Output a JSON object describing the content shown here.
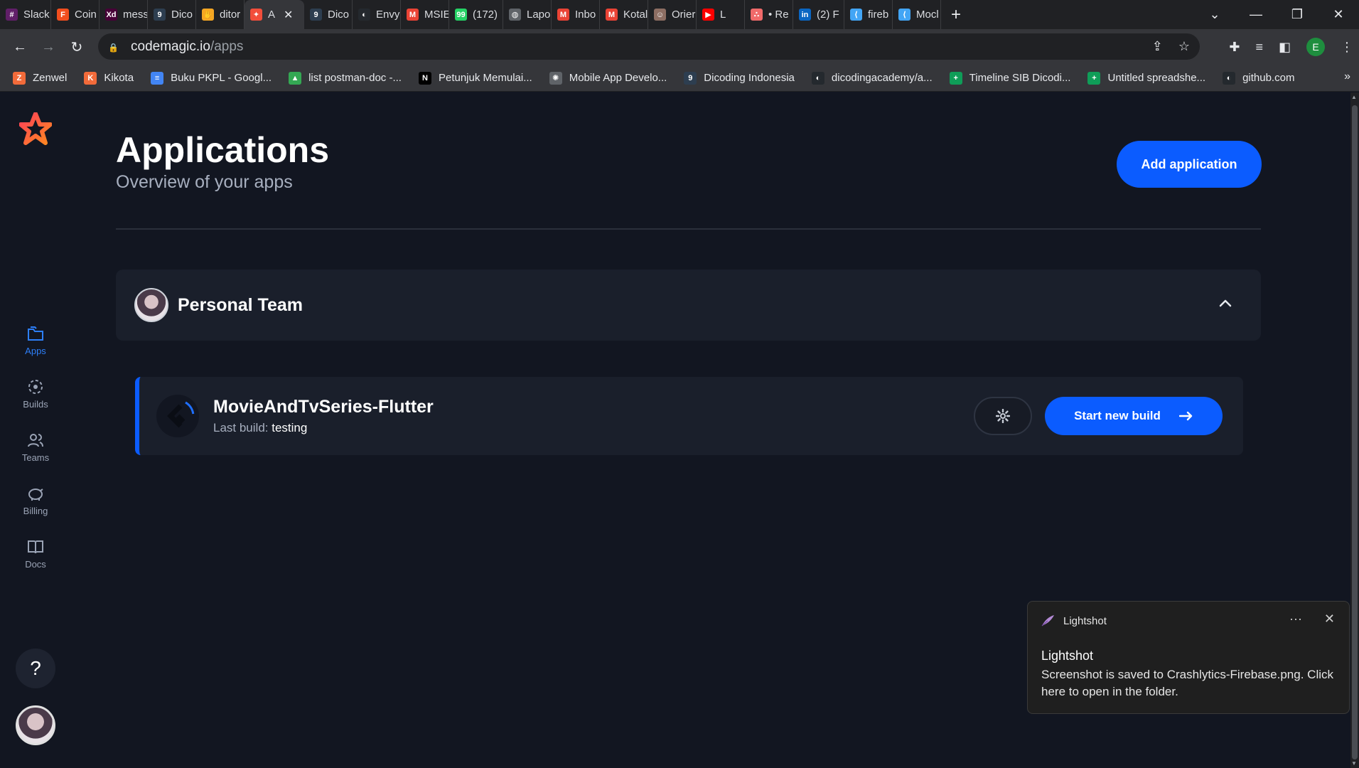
{
  "browser": {
    "tabs": [
      {
        "label": "Slack",
        "icon": "slack-icon",
        "color": "#611f69",
        "glyph": "#"
      },
      {
        "label": "Coin",
        "icon": "figma-icon",
        "color": "#f24e1e",
        "glyph": "F"
      },
      {
        "label": "mess",
        "icon": "xd-icon",
        "color": "#470137",
        "glyph": "Xd"
      },
      {
        "label": "Dico",
        "icon": "dicoding-icon",
        "color": "#2d3e50",
        "glyph": "9"
      },
      {
        "label": "ditor",
        "icon": "hand-icon",
        "color": "#f5a623",
        "glyph": "✋"
      },
      {
        "label": "A",
        "icon": "codemagic-icon",
        "color": "#f24e3b",
        "glyph": "✦",
        "active": true
      },
      {
        "label": "Dico",
        "icon": "dicoding-icon",
        "color": "#2d3e50",
        "glyph": "9"
      },
      {
        "label": "Envy",
        "icon": "github-icon",
        "color": "#24292e",
        "glyph": "◐"
      },
      {
        "label": "MSIE",
        "icon": "gmail-icon",
        "color": "#ea4335",
        "glyph": "M"
      },
      {
        "label": "(172)",
        "icon": "whatsapp-icon",
        "color": "#25d366",
        "glyph": "99"
      },
      {
        "label": "Lapo",
        "icon": "globe-icon",
        "color": "#5f6368",
        "glyph": "◍"
      },
      {
        "label": "Inbo",
        "icon": "gmail-icon",
        "color": "#ea4335",
        "glyph": "M"
      },
      {
        "label": "Kotal",
        "icon": "gmail-icon",
        "color": "#ea4335",
        "glyph": "M"
      },
      {
        "label": "Orier",
        "icon": "person-icon",
        "color": "#8d6e63",
        "glyph": "☺"
      },
      {
        "label": "L",
        "icon": "youtube-icon",
        "color": "#ff0000",
        "glyph": "▶"
      },
      {
        "label": "• Re",
        "icon": "asana-icon",
        "color": "#f06a6a",
        "glyph": "∴"
      },
      {
        "label": "(2) F",
        "icon": "linkedin-icon",
        "color": "#0a66c2",
        "glyph": "in"
      },
      {
        "label": "fireb",
        "icon": "flutter-icon",
        "color": "#42a5f5",
        "glyph": "⟨"
      },
      {
        "label": "Mocl",
        "icon": "flutter-icon",
        "color": "#42a5f5",
        "glyph": "⟨"
      }
    ],
    "url_host": "codemagic.io",
    "url_path": "/apps",
    "profile_initial": "E",
    "bookmarks": [
      {
        "label": "Zenwel",
        "color": "#f26b3a",
        "glyph": "Z"
      },
      {
        "label": "Kikota",
        "color": "#f26b3a",
        "glyph": "K"
      },
      {
        "label": "Buku PKPL - Googl...",
        "color": "#4285f4",
        "glyph": "≡"
      },
      {
        "label": "list postman-doc -...",
        "color": "#34a853",
        "glyph": "▲"
      },
      {
        "label": "Petunjuk Memulai...",
        "color": "#000000",
        "glyph": "N"
      },
      {
        "label": "Mobile App Develo...",
        "color": "#5f6368",
        "glyph": "✺"
      },
      {
        "label": "Dicoding Indonesia",
        "color": "#2d3e50",
        "glyph": "9"
      },
      {
        "label": "dicodingacademy/a...",
        "color": "#24292e",
        "glyph": "◐"
      },
      {
        "label": "Timeline SIB Dicodi...",
        "color": "#0f9d58",
        "glyph": "+"
      },
      {
        "label": "Untitled spreadshe...",
        "color": "#0f9d58",
        "glyph": "+"
      },
      {
        "label": "github.com",
        "color": "#24292e",
        "glyph": "◐"
      }
    ]
  },
  "sidebar": {
    "items": [
      {
        "label": "Apps",
        "icon": "folder-icon",
        "active": true
      },
      {
        "label": "Builds",
        "icon": "builds-icon"
      },
      {
        "label": "Teams",
        "icon": "teams-icon"
      },
      {
        "label": "Billing",
        "icon": "piggy-bank-icon"
      },
      {
        "label": "Docs",
        "icon": "book-icon"
      }
    ],
    "help_label": "?"
  },
  "header": {
    "title": "Applications",
    "subtitle": "Overview of your apps",
    "add_button": "Add application"
  },
  "team": {
    "name": "Personal Team"
  },
  "app": {
    "name": "MovieAndTvSeries-Flutter",
    "last_build_label": "Last build:",
    "last_build_value": "testing",
    "build_button": "Start new build"
  },
  "toast": {
    "app_name": "Lightshot",
    "title": "Lightshot",
    "message": "Screenshot is saved to Crashlytics-Firebase.png. Click here to open in the folder.",
    "more": "···",
    "close": "✕"
  },
  "colors": {
    "accent": "#0b5cff",
    "background": "#121621",
    "card": "#1a1f2b"
  }
}
